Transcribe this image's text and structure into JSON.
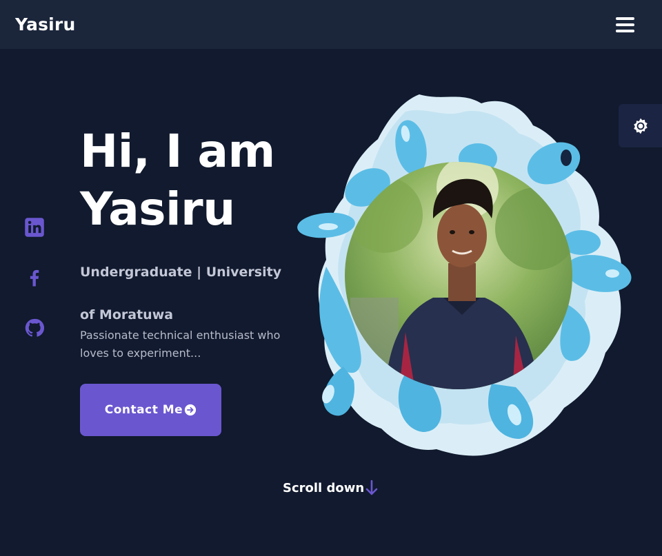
{
  "navbar": {
    "brand": "Yasiru",
    "menu_icon": "hamburger-menu-icon"
  },
  "theme_toggle": {
    "icon": "gear-icon"
  },
  "social": [
    {
      "name": "linkedin",
      "icon": "linkedin-icon"
    },
    {
      "name": "facebook",
      "icon": "facebook-icon"
    },
    {
      "name": "github",
      "icon": "github-icon"
    }
  ],
  "hero": {
    "title_line1": "Hi, I am",
    "title_line2": "Yasiru",
    "subtitle": "Undergraduate | University of Moratuwa",
    "description": "Passionate technical enthusiast who loves to experiment...",
    "contact_button": "Contact Me",
    "scroll_down": "Scroll down"
  },
  "colors": {
    "background": "#111a2e",
    "navbar": "#1b263b",
    "accent": "#6a57cf",
    "splash": "#5bbde6",
    "text_muted": "#c3c7d6"
  }
}
